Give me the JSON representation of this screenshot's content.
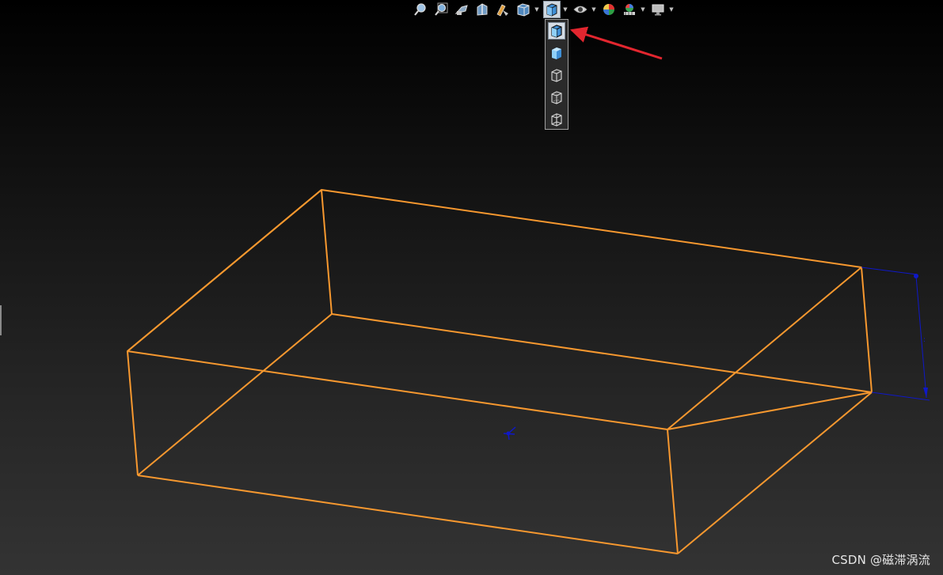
{
  "toolbar": {
    "icons": [
      "zoom-to-fit-icon",
      "zoom-to-area-icon",
      "previous-view-icon",
      "section-view-icon",
      "dynamic-annotation-icon",
      "view-orientation-icon",
      "display-style-icon",
      "hide-show-items-icon",
      "edit-appearance-icon",
      "apply-scene-icon",
      "view-settings-icon"
    ]
  },
  "display_style_flyout": {
    "selected": "Shaded With Edges",
    "items": [
      "shaded-with-edges-icon",
      "shaded-icon",
      "hidden-lines-removed-icon",
      "hidden-lines-visible-icon",
      "wireframe-icon"
    ]
  },
  "model": {
    "edge_color": "#f7982f",
    "dimension_color": "#0f18c8"
  },
  "annotation": {
    "arrow_color": "#e3262f"
  },
  "watermark": {
    "text": "CSDN @磁滞涡流"
  }
}
